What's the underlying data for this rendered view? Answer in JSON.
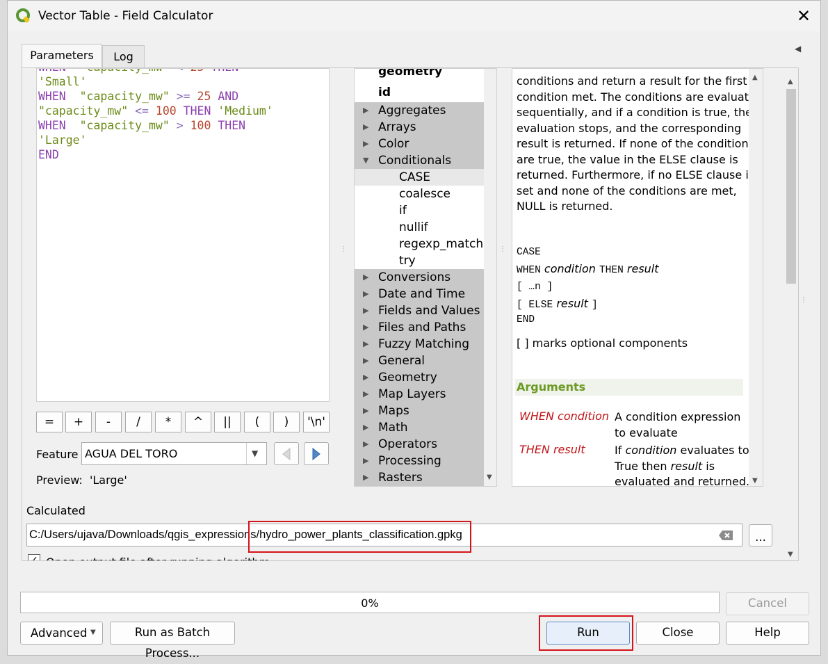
{
  "window": {
    "title": "Vector Table - Field Calculator"
  },
  "tabs": [
    {
      "label": "Parameters"
    },
    {
      "label": "Log"
    }
  ],
  "editor": {
    "lines": [
      {
        "segments": [
          {
            "t": "'Small'",
            "c": "str"
          }
        ]
      },
      {
        "segments": [
          {
            "t": "WHEN",
            "c": "kw"
          },
          {
            "t": "  ",
            "c": ""
          },
          {
            "t": "\"capacity_mw\"",
            "c": "str"
          },
          {
            "t": " >= ",
            "c": "op"
          },
          {
            "t": "25",
            "c": "num"
          },
          {
            "t": " AND",
            "c": "kw"
          }
        ]
      },
      {
        "segments": [
          {
            "t": "\"capacity_mw\"",
            "c": "str"
          },
          {
            "t": " <= ",
            "c": "op"
          },
          {
            "t": "100",
            "c": "num"
          },
          {
            "t": " THEN",
            "c": "kw"
          },
          {
            "t": " 'Medium'",
            "c": "str"
          }
        ]
      },
      {
        "segments": [
          {
            "t": "WHEN",
            "c": "kw"
          },
          {
            "t": "  ",
            "c": ""
          },
          {
            "t": "\"capacity_mw\"",
            "c": "str"
          },
          {
            "t": " > ",
            "c": "op"
          },
          {
            "t": "100",
            "c": "num"
          },
          {
            "t": " THEN",
            "c": "kw"
          }
        ]
      },
      {
        "segments": [
          {
            "t": "'Large'",
            "c": "str"
          }
        ]
      },
      {
        "segments": [
          {
            "t": "END",
            "c": "kw"
          }
        ]
      }
    ]
  },
  "operators": [
    "=",
    "+",
    "-",
    "/",
    "*",
    "^",
    "||",
    "(",
    ")",
    "'\\n'"
  ],
  "feature": {
    "label": "Feature",
    "value": "AGUA DEL TORO"
  },
  "preview": {
    "label": "Preview:",
    "value": "'Large'"
  },
  "function_tree": {
    "top_items": [
      "geometry",
      "id"
    ],
    "items": [
      {
        "label": "Aggregates",
        "type": "group",
        "expanded": false
      },
      {
        "label": "Arrays",
        "type": "group",
        "expanded": false
      },
      {
        "label": "Color",
        "type": "group",
        "expanded": false
      },
      {
        "label": "Conditionals",
        "type": "group",
        "expanded": true
      },
      {
        "label": "CASE",
        "type": "child",
        "selected": true
      },
      {
        "label": "coalesce",
        "type": "child"
      },
      {
        "label": "if",
        "type": "child"
      },
      {
        "label": "nullif",
        "type": "child"
      },
      {
        "label": "regexp_match",
        "type": "child"
      },
      {
        "label": "try",
        "type": "child"
      },
      {
        "label": "Conversions",
        "type": "group",
        "expanded": false
      },
      {
        "label": "Date and Time",
        "type": "group",
        "expanded": false
      },
      {
        "label": "Fields and Values",
        "type": "group",
        "expanded": false
      },
      {
        "label": "Files and Paths",
        "type": "group",
        "expanded": false
      },
      {
        "label": "Fuzzy Matching",
        "type": "group",
        "expanded": false
      },
      {
        "label": "General",
        "type": "group",
        "expanded": false
      },
      {
        "label": "Geometry",
        "type": "group",
        "expanded": false
      },
      {
        "label": "Map Layers",
        "type": "group",
        "expanded": false
      },
      {
        "label": "Maps",
        "type": "group",
        "expanded": false
      },
      {
        "label": "Math",
        "type": "group",
        "expanded": false
      },
      {
        "label": "Operators",
        "type": "group",
        "expanded": false
      },
      {
        "label": "Processing",
        "type": "group",
        "expanded": false
      },
      {
        "label": "Rasters",
        "type": "group",
        "expanded": false
      }
    ]
  },
  "help": {
    "description_lines": [
      "conditions and return a result for the first",
      "condition met. The conditions are evaluated",
      "sequentially, and if a condition is true, the",
      "evaluation stops, and the corresponding",
      "result is returned. If none of the conditions",
      "are true, the value in the ELSE clause is",
      "returned. Furthermore, if no ELSE clause is",
      "set and none of the conditions are met,",
      "NULL is returned."
    ],
    "syntax": {
      "case": "CASE",
      "when": "WHEN",
      "condition": "condition",
      "then": "THEN",
      "result": "result",
      "dots": "[ …n ]",
      "else_open": "[ ELSE",
      "else_result": "result",
      "else_close": "]",
      "end": "END"
    },
    "optional_note": "[ ] marks optional components",
    "arguments_heading": "Arguments",
    "arguments": [
      {
        "name": "WHEN condition",
        "desc_lines": [
          "A condition expression",
          "to evaluate"
        ]
      },
      {
        "name": "THEN result",
        "desc_parts": [
          "If ",
          "condition",
          " evaluates to"
        ],
        "desc_line2_parts": [
          "True then ",
          "result",
          " is"
        ],
        "desc_line3": "evaluated and returned."
      }
    ]
  },
  "calculated": {
    "label": "Calculated",
    "path": "C:/Users/ujava/Downloads/qgis_expressions/hydro_power_plants_classification.gpkg",
    "browse_label": "...",
    "open_output_label": "Open output file after running algorithm",
    "open_output_checked": true
  },
  "progress": {
    "text": "0%",
    "value": 0
  },
  "buttons": {
    "cancel": "Cancel",
    "advanced": "Advanced",
    "batch": "Run as Batch Process...",
    "run": "Run",
    "close": "Close",
    "help": "Help"
  },
  "colors": {
    "highlight_red": "#d4141a",
    "keyword": "#8b3fb0",
    "string": "#6a8a16",
    "number": "#b5462e",
    "arg_name": "#c0141a",
    "args_header": "#6b9b22",
    "qgis_green": "#589632"
  }
}
